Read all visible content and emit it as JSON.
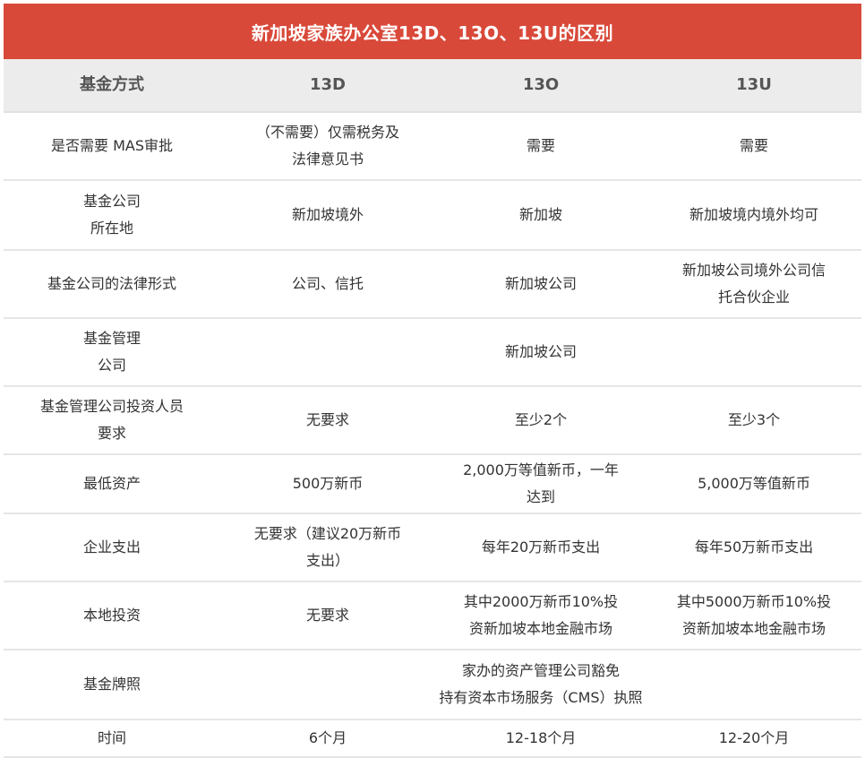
{
  "title": "新加坡家族办公室13D、13O、13U的区别",
  "header": {
    "label": "基金方式",
    "col_13d": "13D",
    "col_13o": "13O",
    "col_13u": "13U"
  },
  "rows": [
    {
      "label": [
        "是否需要 MAS审批"
      ],
      "c13d": [
        "（不需要）仅需税务及",
        "法律意见书"
      ],
      "c13o": [
        "需要"
      ],
      "c13u": [
        "需要"
      ]
    },
    {
      "label": [
        "基金公司",
        "所在地"
      ],
      "c13d": [
        "新加坡境外"
      ],
      "c13o": [
        "新加坡"
      ],
      "c13u": [
        "新加坡境内境外均可"
      ]
    },
    {
      "label": [
        "基金公司的法律形式"
      ],
      "c13d": [
        "公司、信托"
      ],
      "c13o": [
        "新加坡公司"
      ],
      "c13u": [
        "新加坡公司境外公司信",
        "托合伙企业"
      ]
    },
    {
      "label": [
        "基金管理",
        "公司"
      ],
      "merged": [
        "新加坡公司"
      ]
    },
    {
      "label": [
        "基金管理公司投资人员",
        "要求"
      ],
      "c13d": [
        "无要求"
      ],
      "c13o": [
        "至少2个"
      ],
      "c13u": [
        "至少3个"
      ]
    },
    {
      "label": [
        "最低资产"
      ],
      "c13d": [
        "500万新币"
      ],
      "c13o": [
        "2,000万等值新币，一年",
        "达到"
      ],
      "c13u": [
        "5,000万等值新币"
      ]
    },
    {
      "label": [
        "企业支出"
      ],
      "c13d": [
        "无要求（建议20万新币",
        "支出）"
      ],
      "c13o": [
        "每年20万新币支出"
      ],
      "c13u": [
        "每年50万新币支出"
      ]
    },
    {
      "label": [
        "本地投资"
      ],
      "c13d": [
        "无要求"
      ],
      "c13o": [
        "其中2000万新币10%投",
        "资新加坡本地金融市场"
      ],
      "c13u": [
        "其中5000万新币10%投",
        "资新加坡本地金融市场"
      ]
    },
    {
      "label": [
        "基金牌照"
      ],
      "merged": [
        "家办的资产管理公司豁免",
        "持有资本市场服务（CMS）执照"
      ]
    },
    {
      "label": [
        "时间"
      ],
      "c13d": [
        "6个月"
      ],
      "c13o": [
        "12-18个月"
      ],
      "c13u": [
        "12-20个月"
      ]
    }
  ],
  "colors": {
    "title_bg": "#d9493a",
    "title_text": "#ffffff",
    "header_bg": "#ececec",
    "row_divider": "#e6e6e6"
  }
}
